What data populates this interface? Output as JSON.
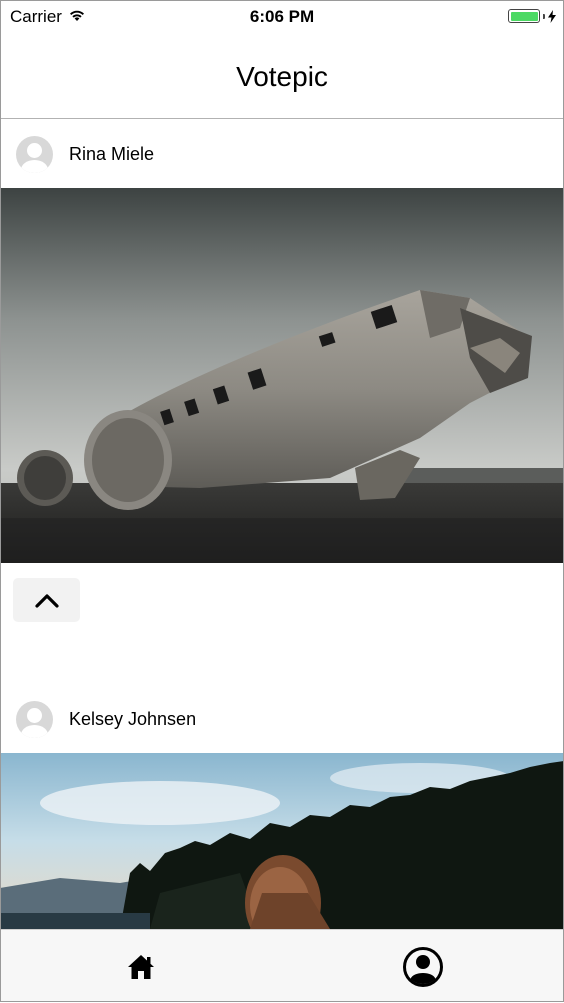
{
  "status_bar": {
    "carrier": "Carrier",
    "time": "6:06 PM",
    "battery_color": "#4cd964"
  },
  "nav": {
    "title": "Votepic"
  },
  "feed": [
    {
      "author": "Rina Miele",
      "photo": "wrecked-airplane-on-black-sand",
      "vote_icon": "chevron-up-icon"
    },
    {
      "author": "Kelsey Johnsen",
      "photo": "woman-before-pine-forest-at-sunset"
    }
  ],
  "tab_bar": {
    "items": [
      {
        "icon": "home-icon"
      },
      {
        "icon": "profile-icon"
      }
    ]
  }
}
